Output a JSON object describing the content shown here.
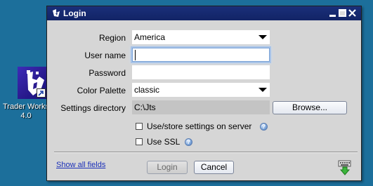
{
  "desktop": {
    "icon_name": "trader-workstation-icon",
    "icon_label": "Trader Works 4.0"
  },
  "window": {
    "title": "Login",
    "title_icon": "login-app-icon"
  },
  "form": {
    "region_label": "Region",
    "region_value": "America",
    "username_label": "User name",
    "username_value": "",
    "password_label": "Password",
    "password_value": "",
    "palette_label": "Color Palette",
    "palette_value": "classic",
    "settings_label": "Settings directory",
    "settings_value": "C:\\Jts",
    "browse_label": "Browse..."
  },
  "options": {
    "store_settings_label": "Use/store settings on server",
    "store_settings_checked": false,
    "ssl_label": "Use SSL",
    "ssl_checked": false
  },
  "footer": {
    "show_all_label": "Show all fields",
    "login_label": "Login",
    "cancel_label": "Cancel",
    "keyboard_icon": "keyboard-icon"
  },
  "colors": {
    "desktop_bg": "#1c6f9b",
    "titlebar": "#1a2f7a",
    "link": "#1a2fb8"
  }
}
